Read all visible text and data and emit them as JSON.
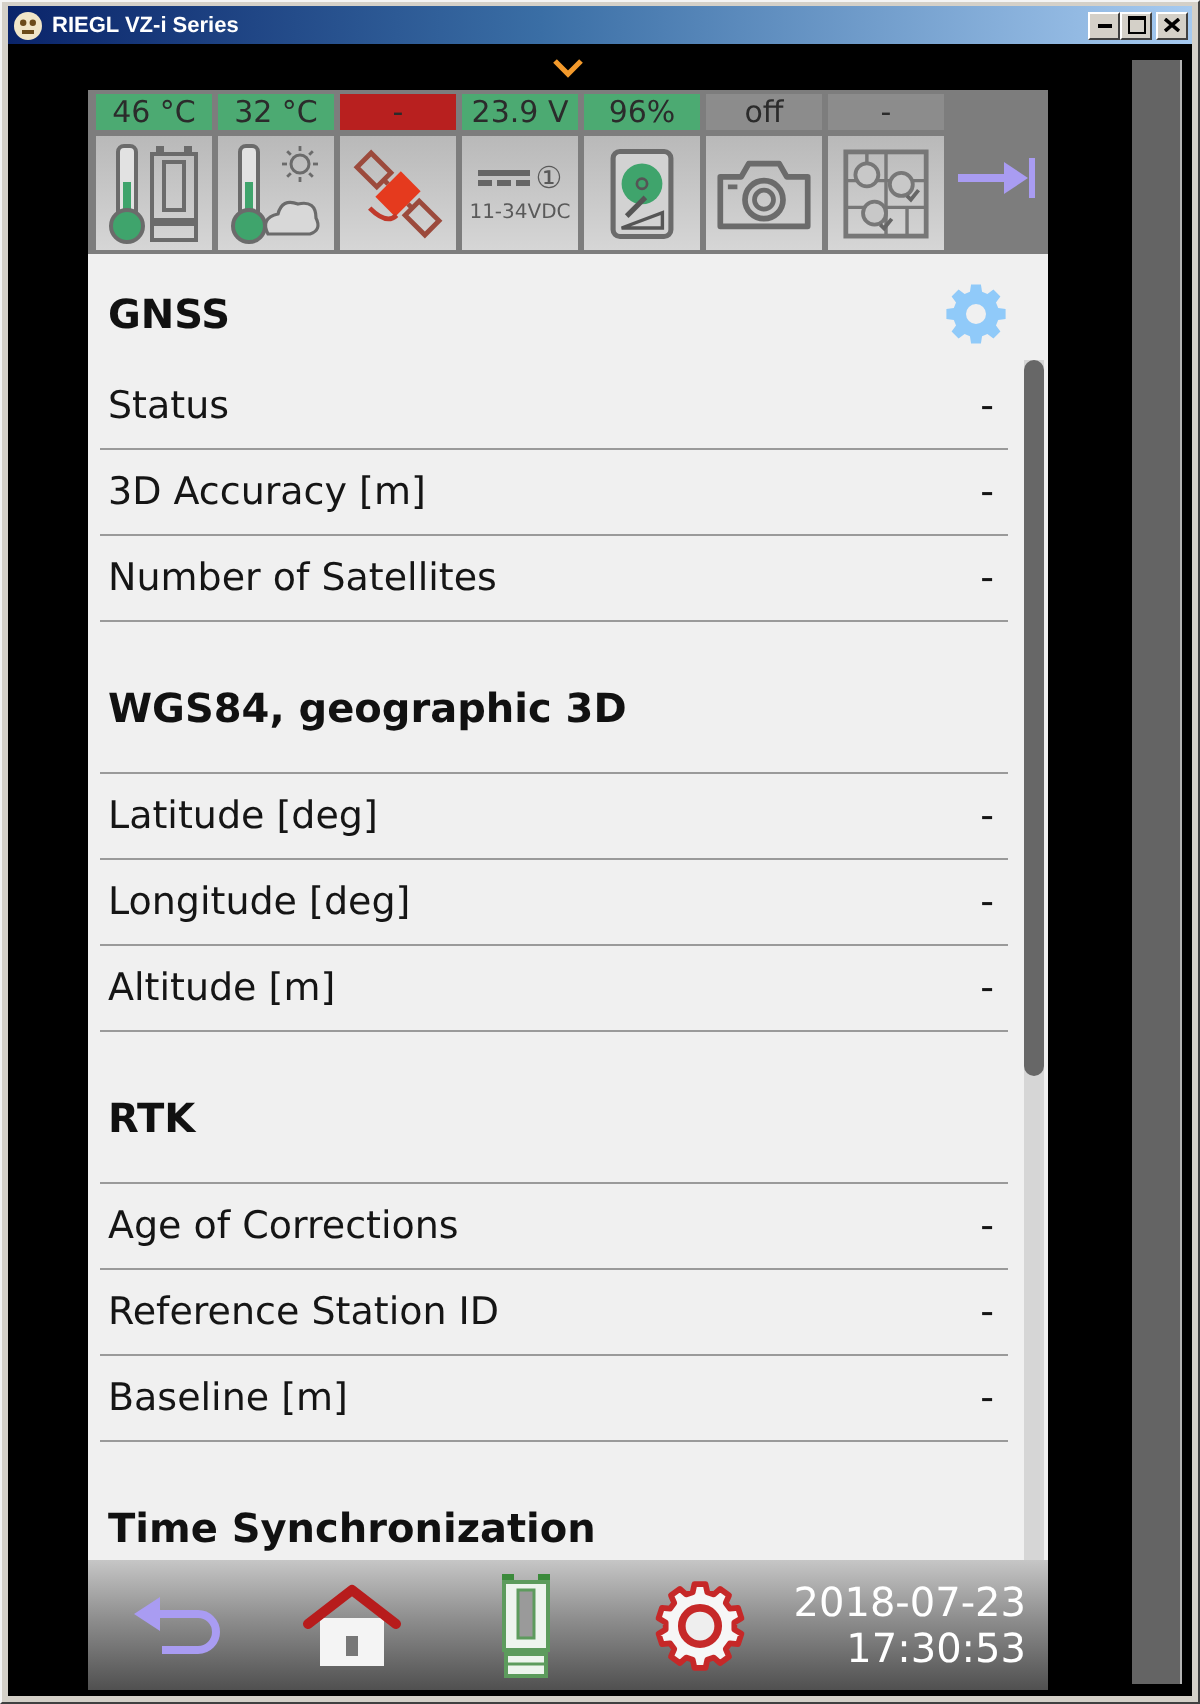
{
  "window": {
    "title": "RIEGL VZ-i Series"
  },
  "status_tiles": [
    {
      "kind": "scanner_temperature",
      "reading": "46 °C",
      "color": "#4caa72"
    },
    {
      "kind": "ambient_temperature",
      "reading": "32 °C",
      "color": "#4caa72"
    },
    {
      "kind": "gnss",
      "reading": "-",
      "color": "#b8201f"
    },
    {
      "kind": "power",
      "reading": "23.9 V",
      "color": "#4caa72",
      "badge": "①",
      "caption": "11-34VDC"
    },
    {
      "kind": "storage",
      "reading": "96%",
      "color": "#4caa72"
    },
    {
      "kind": "camera",
      "reading": "off",
      "color": "#8c8c8c"
    },
    {
      "kind": "registration",
      "reading": "-",
      "color": "#8c8c8c"
    }
  ],
  "sections": [
    {
      "title": "GNSS",
      "has_settings": true,
      "rows": [
        {
          "label": "Status",
          "value": "-"
        },
        {
          "label": "3D Accuracy [m]",
          "value": "-"
        },
        {
          "label": "Number of Satellites",
          "value": "-"
        }
      ]
    },
    {
      "title": "WGS84, geographic 3D",
      "has_settings": false,
      "rows": [
        {
          "label": "Latitude [deg]",
          "value": "-"
        },
        {
          "label": "Longitude [deg]",
          "value": "-"
        },
        {
          "label": "Altitude [m]",
          "value": "-"
        }
      ]
    },
    {
      "title": "RTK",
      "has_settings": false,
      "rows": [
        {
          "label": "Age of Corrections",
          "value": "-"
        },
        {
          "label": "Reference Station ID",
          "value": "-"
        },
        {
          "label": "Baseline [m]",
          "value": "-"
        }
      ]
    },
    {
      "title": "Time Synchronization",
      "has_settings": false
    }
  ],
  "bottom_bar": {
    "buttons": [
      {
        "kind": "back"
      },
      {
        "kind": "home"
      },
      {
        "kind": "scanner"
      },
      {
        "kind": "settings"
      }
    ],
    "date": "2018-07-23",
    "time": "17:30:53"
  }
}
